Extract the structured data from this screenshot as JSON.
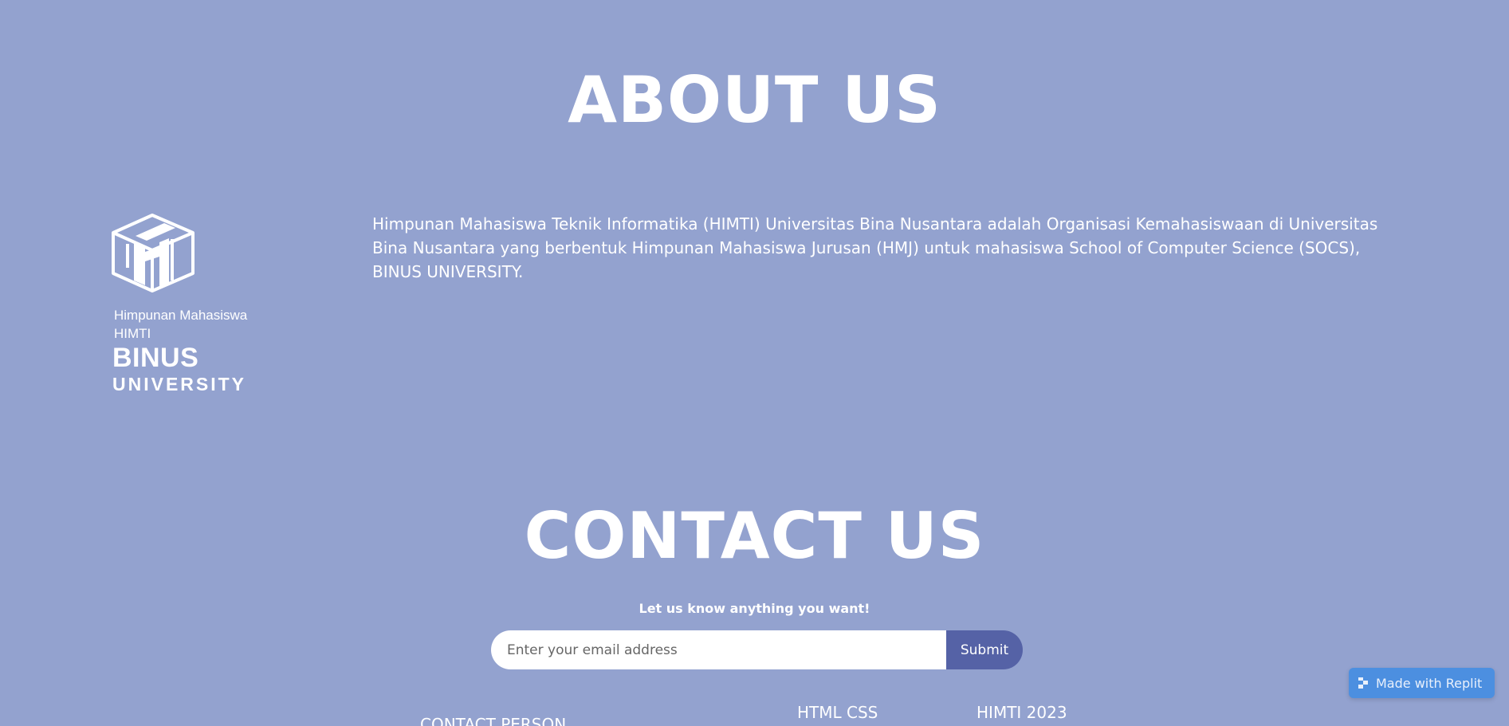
{
  "about": {
    "title": "ABOUT US",
    "description": "Himpunan Mahasiswa Teknik Informatika (HIMTI) Universitas Bina Nusantara adalah Organisasi Kemahasiswaan di Universitas Bina Nusantara yang berbentuk Himpunan Mahasiswa Jurusan (HMJ) untuk mahasiswa School of Computer Science (SOCS), BINUS UNIVERSITY."
  },
  "logo": {
    "line1": "Himpunan Mahasiswa",
    "line2": "HIMTI",
    "line3": "BINUS",
    "line4": "UNIVERSITY"
  },
  "contact": {
    "title": "CONTACT US",
    "subtitle": "Let us know anything you want!",
    "email_placeholder": "Enter your email address",
    "submit_label": "Submit"
  },
  "footer": {
    "contact_person": "CONTACT PERSON",
    "html_css": "HTML CSS",
    "himti": "HIMTI 2023"
  },
  "badge": {
    "label": "Made with Replit"
  },
  "colors": {
    "background": "#93a2cf",
    "submit": "#5562a6",
    "badge": "#4c8fe0"
  }
}
